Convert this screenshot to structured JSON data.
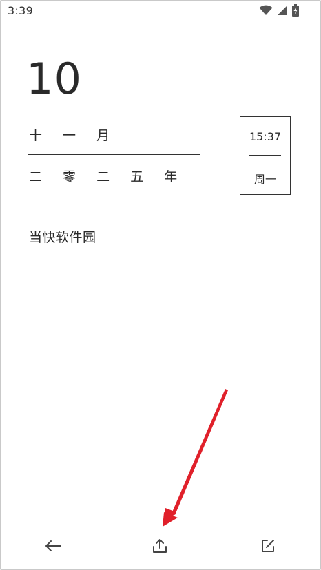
{
  "status_bar": {
    "time": "3:39",
    "icons": [
      "wifi-icon",
      "signal-icon",
      "battery-charging-icon"
    ]
  },
  "calendar": {
    "day": "10",
    "month": "十 一 月",
    "year": "二 零 二 五 年"
  },
  "time_box": {
    "time": "15:37",
    "weekday": "周一"
  },
  "note": {
    "text": "当快软件园"
  },
  "toolbar": {
    "buttons": [
      "back-arrow-icon",
      "share-upload-icon",
      "edit-icon"
    ]
  },
  "colors": {
    "annotation_arrow": "#e0202a",
    "text": "#2a2a2a",
    "background": "#ffffff"
  }
}
